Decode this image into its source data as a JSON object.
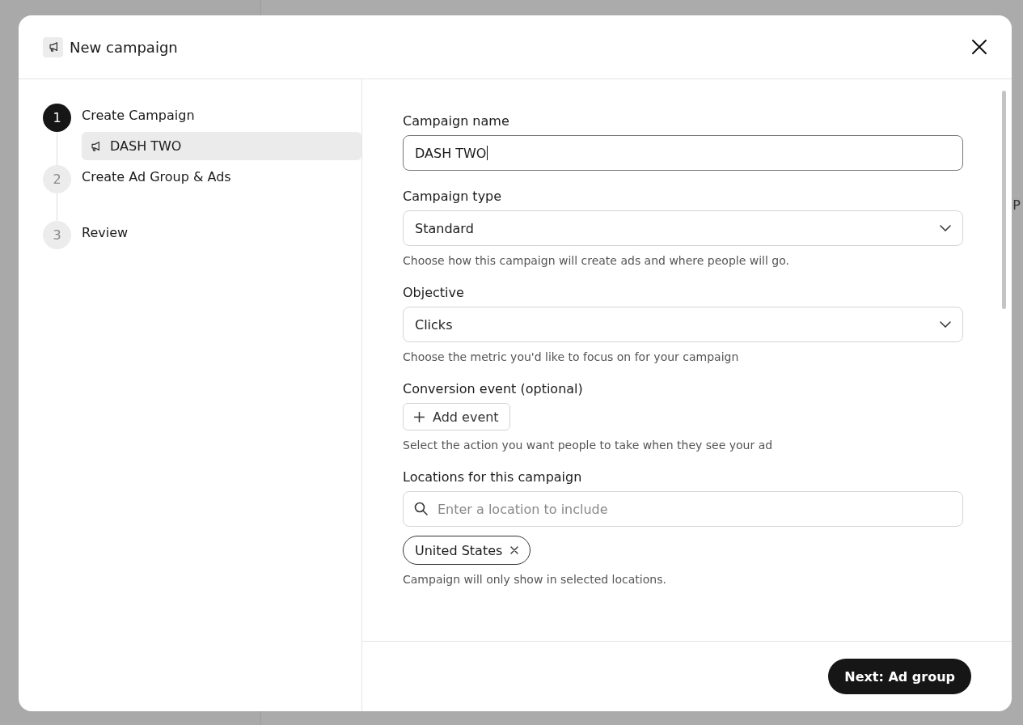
{
  "background": {
    "cut_text": "P"
  },
  "dialog": {
    "title": "New campaign",
    "steps": [
      {
        "number": "1",
        "label": "Create Campaign",
        "current": true,
        "children": [
          {
            "label": "DASH TWO",
            "selected": true
          }
        ]
      },
      {
        "number": "2",
        "label": "Create Ad Group & Ads",
        "current": false
      },
      {
        "number": "3",
        "label": "Review",
        "current": false
      }
    ],
    "fields": [
      {
        "kind": "text",
        "label": "Campaign name",
        "value": "DASH TWO",
        "focused": true
      },
      {
        "kind": "select",
        "label": "Campaign type",
        "value": "Standard",
        "help": "Choose how this campaign will create ads and where people will go."
      },
      {
        "kind": "select",
        "label": "Objective",
        "value": "Clicks",
        "help": "Choose the metric you'd like to focus on for your campaign"
      },
      {
        "kind": "add",
        "label": "Conversion event (optional)",
        "button": "Add event",
        "help": "Select the action you want people to take when they see your ad"
      },
      {
        "kind": "location",
        "label": "Locations for this campaign",
        "placeholder": "Enter a location to include",
        "chips": [
          "United States"
        ],
        "help": "Campaign will only show in selected locations."
      }
    ],
    "primary_button": "Next: Ad group"
  }
}
